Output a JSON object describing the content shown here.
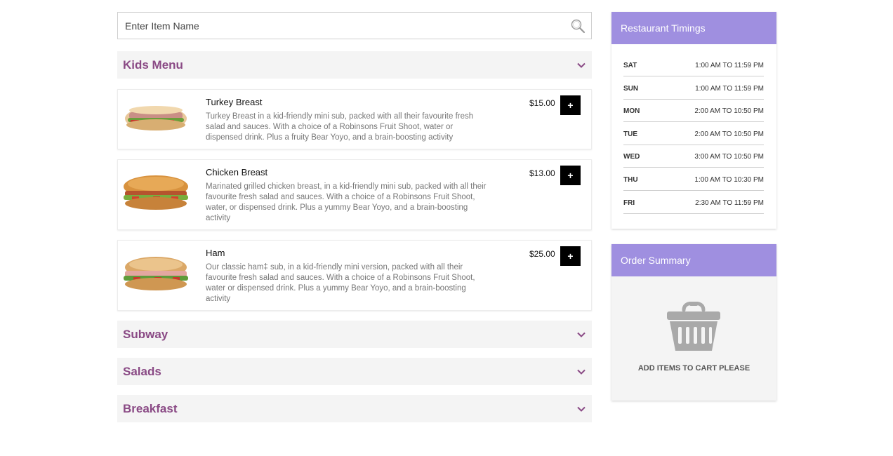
{
  "search": {
    "placeholder": "Enter Item Name",
    "icon": "search-icon"
  },
  "menu": {
    "categories": [
      {
        "title": "Kids Menu",
        "expanded": true
      },
      {
        "title": "Subway",
        "expanded": false
      },
      {
        "title": "Salads",
        "expanded": false
      },
      {
        "title": "Breakfast",
        "expanded": false
      }
    ],
    "kids_items": [
      {
        "name": "Turkey Breast",
        "description": "Turkey Breast in a kid-friendly mini sub, packed with all their favourite fresh salad and sauces. With a choice of a Robinsons Fruit Shoot, water or dispensed drink. Plus a fruity Bear Yoyo, and a brain-boosting activity",
        "price": "$15.00",
        "add_label": "+"
      },
      {
        "name": "Chicken Breast",
        "description": "Marinated grilled chicken breast, in a kid-friendly mini sub, packed with all their favourite fresh salad and sauces. With a choice of a Robinsons Fruit Shoot, water, or dispensed drink. Plus a yummy Bear Yoyo, and a brain-boosting activity",
        "price": "$13.00",
        "add_label": "+"
      },
      {
        "name": "Ham",
        "description": "Our classic ham‡ sub, in a kid-friendly mini version, packed with all their favourite fresh salad and sauces. With a choice of a Robinsons Fruit Shoot, water or dispensed drink. Plus a yummy Bear Yoyo, and a brain-boosting activity",
        "price": "$25.00",
        "add_label": "+"
      }
    ]
  },
  "timings": {
    "title": "Restaurant Timings",
    "rows": [
      {
        "day": "SAT",
        "hours": "1:00 AM TO 11:59 PM"
      },
      {
        "day": "SUN",
        "hours": "1:00 AM TO 11:59 PM"
      },
      {
        "day": "MON",
        "hours": "2:00 AM TO 10:50 PM"
      },
      {
        "day": "TUE",
        "hours": "2:00 AM TO 10:50 PM"
      },
      {
        "day": "WED",
        "hours": "3:00 AM TO 10:50 PM"
      },
      {
        "day": "THU",
        "hours": "1:00 AM TO 10:30 PM"
      },
      {
        "day": "FRI",
        "hours": "2:30 AM TO 11:59 PM"
      }
    ]
  },
  "order_summary": {
    "title": "Order Summary",
    "empty_message": "ADD ITEMS TO CART PLEASE",
    "icon": "basket-icon"
  },
  "colors": {
    "accent": "#9f8fe0",
    "category_title": "#8a4a85",
    "category_bg": "#f4f4f4",
    "add_button": "#000000"
  }
}
